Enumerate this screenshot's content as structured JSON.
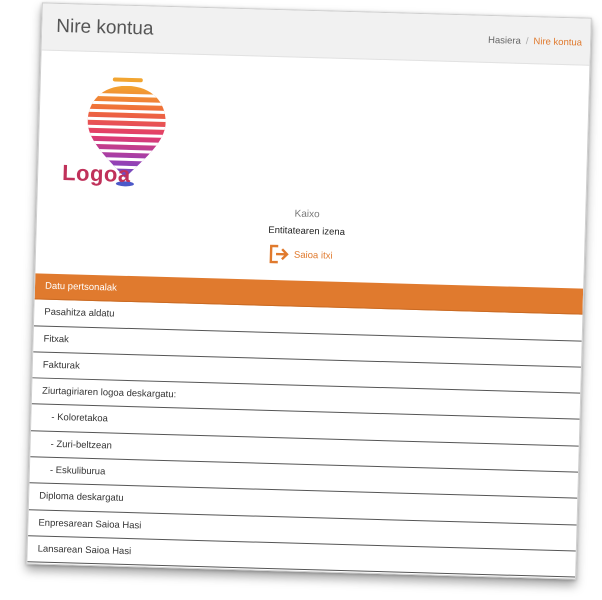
{
  "header": {
    "title": "Nire kontua"
  },
  "breadcrumb": {
    "home": "Hasiera",
    "separator": "/",
    "current": "Nire kontua"
  },
  "logo": {
    "text": "Logoa"
  },
  "user": {
    "greeting": "Kaixo",
    "entity_name": "Entitatearen izena",
    "logout_label": "Saioa itxi"
  },
  "menu": {
    "items": [
      {
        "label": "Datu pertsonalak",
        "active": true
      },
      {
        "label": "Pasahitza aldatu"
      },
      {
        "label": "Fitxak"
      },
      {
        "label": "Fakturak"
      },
      {
        "label": "Ziurtagiriaren logoa deskargatu:"
      },
      {
        "label": "- Koloretakoa"
      },
      {
        "label": "- Zuri-beltzean"
      },
      {
        "label": "- Eskuliburua"
      },
      {
        "label": "Diploma deskargatu"
      },
      {
        "label": "Enpresarean Saioa Hasi"
      },
      {
        "label": "Lansarean Saioa Hasi"
      }
    ]
  },
  "colors": {
    "accent": "#e07a2e",
    "logo_text": "#c0315a"
  }
}
